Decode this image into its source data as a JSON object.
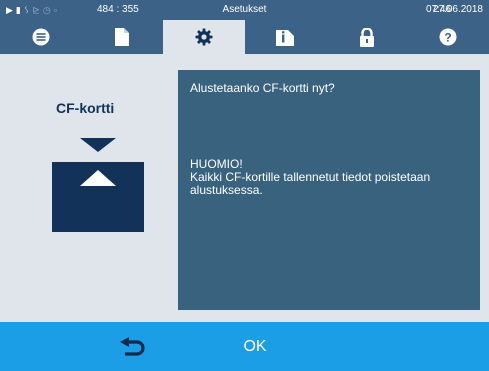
{
  "status_bar": {
    "icons": [
      "play-icon",
      "document-icon",
      "steam-icon",
      "graph-icon",
      "clock-icon",
      "lock-icon"
    ],
    "coords": "484 : 355",
    "title": "Asetukset",
    "time": "07:46",
    "date": "27.06.2018"
  },
  "tabs": [
    {
      "name": "menu",
      "icon": "list-icon"
    },
    {
      "name": "document",
      "icon": "document-icon"
    },
    {
      "name": "settings",
      "icon": "gear-icon",
      "active": true
    },
    {
      "name": "info",
      "icon": "info-icon"
    },
    {
      "name": "lock",
      "icon": "lock-icon"
    },
    {
      "name": "help",
      "icon": "help-icon"
    }
  ],
  "side": {
    "title": "CF-kortti",
    "icon": "cf-card-format-icon"
  },
  "message": {
    "question": "Alustetaanko CF-kortti nyt?",
    "warning_title": "HUOMIO!",
    "warning_line1": "Kaikki CF-kortille tallennetut tiedot poistetaan",
    "warning_line2": "alustuksessa."
  },
  "bottom_bar": {
    "back_icon": "back-arrow-icon",
    "ok_label": "OK"
  },
  "colors": {
    "header": "#3d6288",
    "content_bg": "#dfe5eb",
    "message_panel": "#39627f",
    "bottom_bar": "#1c9ee6",
    "icon_dark": "#12325a"
  }
}
